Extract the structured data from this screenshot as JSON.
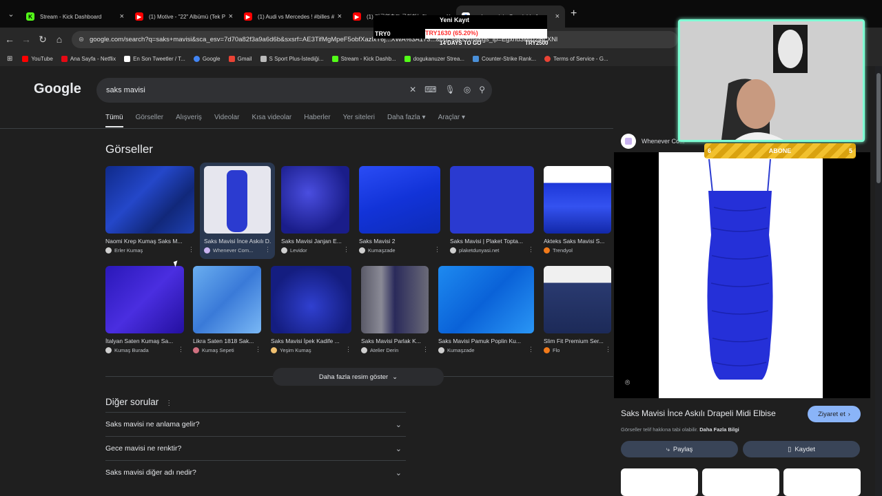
{
  "browser": {
    "tabs": [
      {
        "title": "Stream - Kick Dashboard",
        "color": "#53fc18",
        "glyph": "K"
      },
      {
        "title": "(1) Motive - \"22\" Albümü (Tek P",
        "color": "#ff0000",
        "glyph": "▶"
      },
      {
        "title": "(1) Audi vs Mercedes ! #billes #",
        "color": "#ff0000",
        "glyph": "▶"
      },
      {
        "title": "(1) 미국연출도 극찬하는?!",
        "color": "#ff0000",
        "glyph": "▶"
      },
      {
        "title": "saks mavisi - Google'da Ara",
        "color": "#4285f4",
        "glyph": "G",
        "active": true
      }
    ],
    "url": "google.com/search?q=saks+mavisi&sca_esv=7d70a82f3a9a6d6b&sxsrf=AE3TifMgMpeF5obfXazlxT6j...XWA%3A173...&oq=saks+ma&gs_lp=Egxnd3Mtd2l6LXNl",
    "bookmarks": [
      {
        "label": "YouTube",
        "color": "#ff0000"
      },
      {
        "label": "Ana Sayfa - Netflix",
        "color": "#e50914"
      },
      {
        "label": "En Son Tweetler / T...",
        "color": "#ffffff"
      },
      {
        "label": "Google",
        "color": "#4285f4"
      },
      {
        "label": "Gmail",
        "color": "#ea4335"
      },
      {
        "label": "S Sport Plus-İstediği...",
        "color": "#bbbbbb"
      },
      {
        "label": "Stream - Kick Dashb...",
        "color": "#53fc18"
      },
      {
        "label": "dogukanuzer Strea...",
        "color": "#53fc18"
      },
      {
        "label": "Counter-Strike Rank...",
        "color": "#4a90d9"
      },
      {
        "label": "Terms of Service - G...",
        "color": "#ea4335"
      }
    ]
  },
  "google": {
    "logo": "Google",
    "query": "saks mavisi",
    "filters": [
      "Tümü",
      "Görseller",
      "Alışveriş",
      "Videolar",
      "Kısa videolar",
      "Haberler",
      "Yer siteleri",
      "Daha fazla ▾",
      "Araçlar ▾"
    ],
    "images_heading": "Görseller",
    "row1": [
      {
        "caption": "Naomi Krep Kumaş Saks M...",
        "source": "Erler Kumaş",
        "color": "#1e3fb0"
      },
      {
        "caption": "Saks Mavisi İnce Askılı D...",
        "source": "Whenever Com...",
        "color": "#2b3bd0"
      },
      {
        "caption": "Saks Mavisi Janjan E...",
        "source": "Levidor",
        "color": "#2a2fb0"
      },
      {
        "caption": "Saks Mavisi 2",
        "source": "Kumaşzade",
        "color": "#1a3be8"
      },
      {
        "caption": "Saks Mavisi | Plaket Topta...",
        "source": "plaketdunyasi.net",
        "color": "#2a3ad0"
      },
      {
        "caption": "Akteks Saks Mavisi S...",
        "source": "Trendyol",
        "color": "#1d37d8"
      }
    ],
    "row2": [
      {
        "caption": "İtalyan Saten Kumaş Sa...",
        "source": "Kumaş Burada",
        "color": "#3a20c8"
      },
      {
        "caption": "Likra Saten 1818 Sak...",
        "source": "Kumaş Sepeti",
        "color": "#4a8ee0"
      },
      {
        "caption": "Saks Mavisi İpek Kadife ...",
        "source": "Yeşim Kumaş",
        "color": "#1c2aa8"
      },
      {
        "caption": "Saks Mavisi Parlak K...",
        "source": "Atelier Derin",
        "color": "#3a3a6a"
      },
      {
        "caption": "Saks Mavisi Pamuk Poplin Ku...",
        "source": "Kumaşzade",
        "color": "#1878e8"
      },
      {
        "caption": "Slim Fit Premium Ser...",
        "source": "Flo",
        "color": "#2a3a70"
      }
    ],
    "more_images": "Daha fazla resim göster",
    "other_questions": "Diğer sorular",
    "questions": [
      "Saks mavisi ne anlama gelir?",
      "Gece mavisi ne renktir?",
      "Saks mavisi diğer adı nedir?"
    ]
  },
  "panel": {
    "source": "Whenever Co...",
    "title": "Saks Mavisi İnce Askılı Drapeli Midi Elbise",
    "visit": "Ziyaret et",
    "note": "Görseller telif hakkına tabi olabilir.",
    "note_link": "Daha Fazla Bilgi",
    "share": "Paylaş",
    "save": "Kaydet"
  },
  "overlay": {
    "ticker_top": "Yeni Kayıt",
    "ticker_left": "TRY0",
    "ticker_mid": "TRY1630 (65.20%)",
    "ticker_days": "14 DAYS TO GO",
    "ticker_right": "TRY2500",
    "abone": "ABONE",
    "abone_left": "6",
    "abone_right": "5"
  }
}
